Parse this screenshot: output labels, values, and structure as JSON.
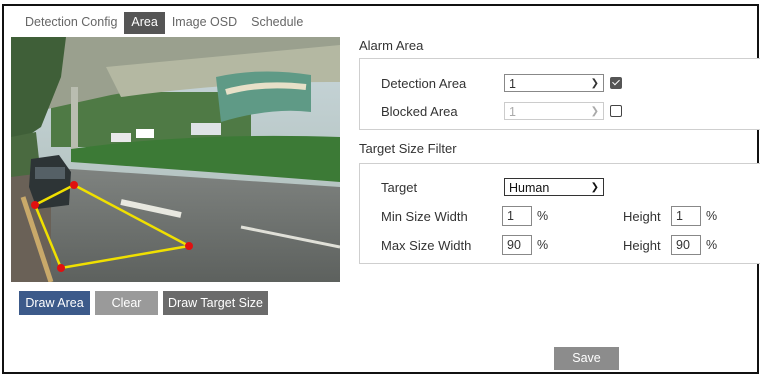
{
  "tabs": [
    {
      "label": "Detection Config",
      "active": false
    },
    {
      "label": "Area",
      "active": true
    },
    {
      "label": "Image OSD",
      "active": false
    },
    {
      "label": "Schedule",
      "active": false
    }
  ],
  "buttons": {
    "draw_area": "Draw Area",
    "clear": "Clear",
    "draw_target_size": "Draw Target Size",
    "save": "Save"
  },
  "alarm_area": {
    "title": "Alarm Area",
    "detection_area_label": "Detection Area",
    "detection_area_value": "1",
    "detection_area_checked": true,
    "blocked_area_label": "Blocked Area",
    "blocked_area_value": "1",
    "blocked_area_checked": false
  },
  "target_size_filter": {
    "title": "Target Size Filter",
    "target_label": "Target",
    "target_value": "Human",
    "min_width_label": "Min Size Width",
    "min_width_value": "1",
    "min_height_label": "Height",
    "min_height_value": "1",
    "max_width_label": "Max Size Width",
    "max_width_value": "90",
    "max_height_label": "Height",
    "max_height_value": "90",
    "unit": "%"
  },
  "colors": {
    "active_tab": "#555555",
    "draw_area_button": "#3c5a8a",
    "gray_button": "#9a9a9a",
    "dark_button": "#6b6b6b",
    "save_button": "#8c8c8c",
    "area_outline": "#f0e000",
    "area_vertex": "#e01010"
  }
}
